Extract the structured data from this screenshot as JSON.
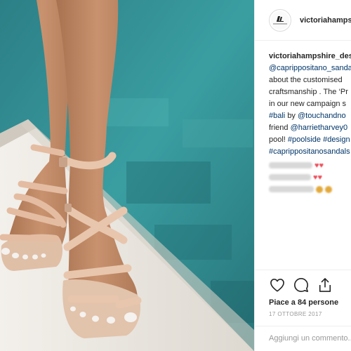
{
  "post": {
    "photo_alt": "sandals-photo",
    "colors": {
      "pool": "#2f8f95",
      "ledge": "#e9e5df",
      "skin": "#c9926f",
      "strap": "#e4bca2",
      "link": "#003569"
    }
  },
  "header": {
    "username": "victoriahampshire_design"
  },
  "caption": {
    "username": "victoriahampshire_design",
    "line1_link": "@caprippositano_sandals",
    "line2": "about the customised",
    "line3": "craftsmanship . The ‘Pr",
    "line4": "in our new campaign s",
    "line5_tag1": "#bali",
    "line5_by": "by",
    "line5_link": "@touchandno",
    "line6_text": "friend",
    "line6_link": "@harrietharvey0",
    "line7_text": "pool!",
    "line7_tag1": "#poolside",
    "line7_tag2": "#design",
    "line8_tag": "#caprippositanosandals"
  },
  "actions": {
    "likes": "Piace a 84 persone",
    "date": "17 OTTOBRE 2017",
    "add_comment_placeholder": "Aggiungi un commento..."
  }
}
